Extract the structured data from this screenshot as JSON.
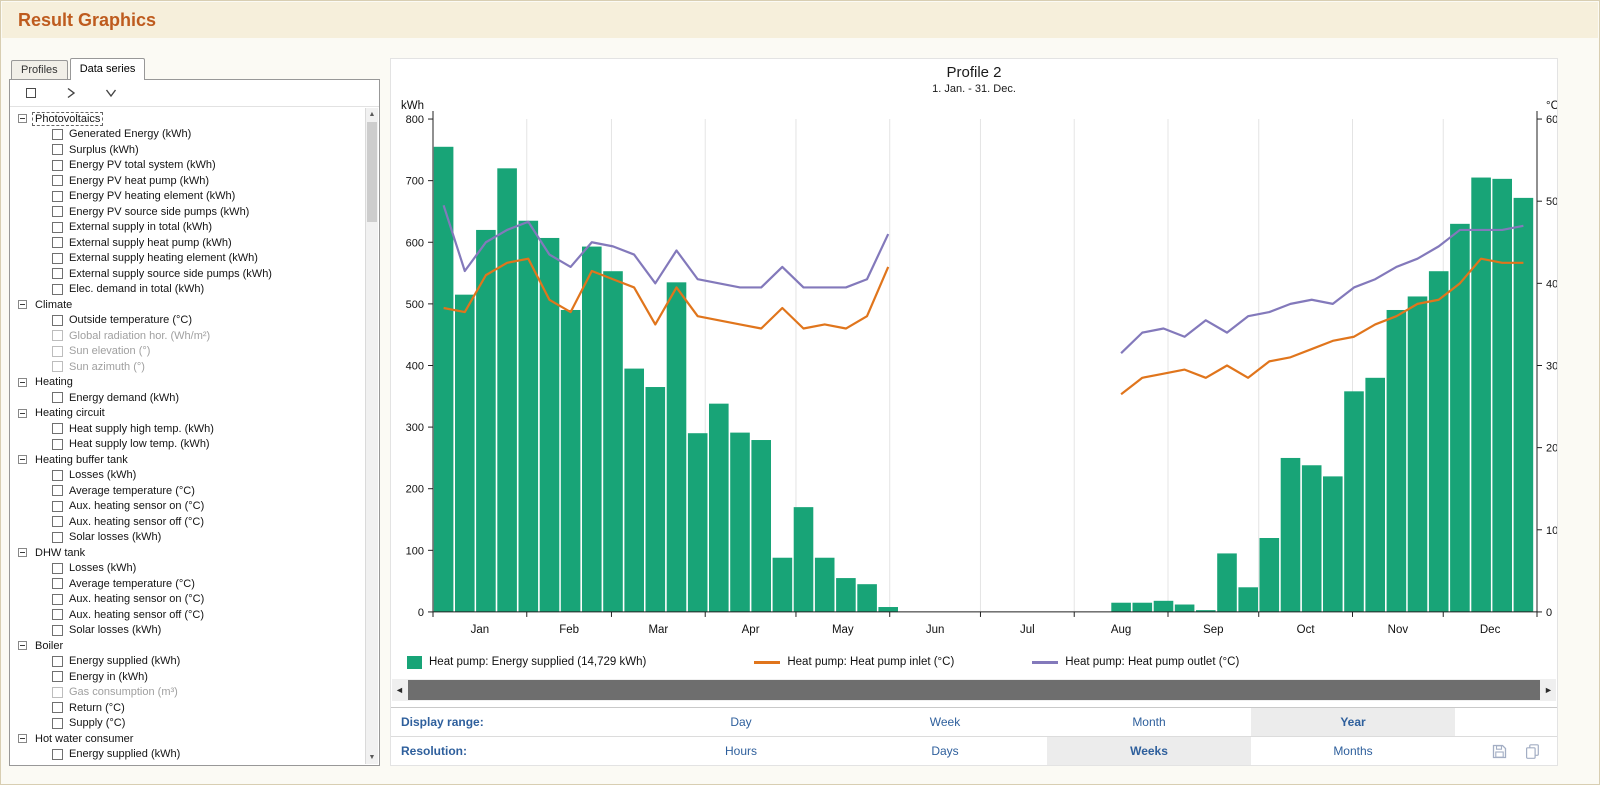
{
  "window": {
    "title": "Result Graphics"
  },
  "left_panel": {
    "tabs": [
      {
        "label": "Profiles",
        "active": false
      },
      {
        "label": "Data series",
        "active": true
      }
    ],
    "toolbar_icons": [
      "checkbox-icon",
      "chevron-right-icon",
      "chevron-down-icon"
    ],
    "tree": [
      {
        "label": "Photovoltaics",
        "focused": true,
        "children": [
          {
            "label": "Generated Energy (kWh)"
          },
          {
            "label": "Surplus (kWh)"
          },
          {
            "label": "Energy PV total system (kWh)"
          },
          {
            "label": "Energy PV heat pump (kWh)"
          },
          {
            "label": "Energy PV heating element (kWh)"
          },
          {
            "label": "Energy PV source side pumps (kWh)"
          },
          {
            "label": "External supply in total (kWh)"
          },
          {
            "label": "External supply heat pump (kWh)"
          },
          {
            "label": "External supply heating element (kWh)"
          },
          {
            "label": "External supply source side pumps (kWh)"
          },
          {
            "label": "Elec. demand in total (kWh)"
          }
        ]
      },
      {
        "label": "Climate",
        "children": [
          {
            "label": "Outside temperature (°C)"
          },
          {
            "label": "Global radiation hor. (Wh/m²)",
            "disabled": true
          },
          {
            "label": "Sun elevation (°)",
            "disabled": true
          },
          {
            "label": "Sun azimuth (°)",
            "disabled": true
          }
        ]
      },
      {
        "label": "Heating",
        "children": [
          {
            "label": "Energy demand (kWh)"
          }
        ]
      },
      {
        "label": "Heating circuit",
        "children": [
          {
            "label": "Heat supply high temp. (kWh)"
          },
          {
            "label": "Heat supply low temp. (kWh)"
          }
        ]
      },
      {
        "label": "Heating buffer tank",
        "children": [
          {
            "label": "Losses (kWh)"
          },
          {
            "label": "Average temperature (°C)"
          },
          {
            "label": "Aux. heating sensor on (°C)"
          },
          {
            "label": "Aux. heating sensor off (°C)"
          },
          {
            "label": "Solar losses (kWh)"
          }
        ]
      },
      {
        "label": "DHW tank",
        "children": [
          {
            "label": "Losses (kWh)"
          },
          {
            "label": "Average temperature (°C)"
          },
          {
            "label": "Aux. heating sensor on (°C)"
          },
          {
            "label": "Aux. heating sensor off (°C)"
          },
          {
            "label": "Solar losses (kWh)"
          }
        ]
      },
      {
        "label": "Boiler",
        "children": [
          {
            "label": "Energy supplied (kWh)"
          },
          {
            "label": "Energy in (kWh)"
          },
          {
            "label": "Gas consumption (m³)",
            "disabled": true
          },
          {
            "label": "Return (°C)"
          },
          {
            "label": "Supply (°C)"
          }
        ]
      },
      {
        "label": "Hot water consumer",
        "children": [
          {
            "label": "Energy supplied (kWh)"
          }
        ]
      }
    ]
  },
  "chart": {
    "title": "Profile 2",
    "subtitle": "1. Jan. - 31. Dec."
  },
  "chart_data": {
    "type": "bar",
    "note": "52 weekly values; bars on left kWh axis, lines on right °C axis",
    "month_labels": [
      "Jan",
      "Feb",
      "Mar",
      "Apr",
      "May",
      "Jun",
      "Jul",
      "Aug",
      "Sep",
      "Oct",
      "Nov",
      "Dec"
    ],
    "month_boundaries_day": [
      0,
      31,
      59,
      90,
      120,
      151,
      181,
      212,
      243,
      273,
      304,
      334,
      365
    ],
    "left_axis": {
      "label": "kWh",
      "min": 0,
      "max": 800,
      "step": 100
    },
    "right_axis": {
      "label": "°C",
      "min": 0,
      "max": 60,
      "step": 10
    },
    "grid_color": "#E4E4E4",
    "series": [
      {
        "name": "Heat pump: Energy supplied (14,729 kWh)",
        "type": "bar",
        "axis": "left",
        "color": "#18A477",
        "values": [
          755,
          515,
          620,
          720,
          635,
          607,
          490,
          593,
          553,
          395,
          365,
          535,
          290,
          338,
          291,
          279,
          88,
          170,
          88,
          55,
          45,
          8,
          0,
          0,
          0,
          0,
          0,
          0,
          0,
          0,
          0,
          0,
          15,
          15,
          18,
          12,
          3,
          95,
          40,
          120,
          250,
          238,
          220,
          358,
          380,
          490,
          512,
          553,
          630,
          705,
          703,
          672
        ]
      },
      {
        "name": "Heat pump: Heat pump inlet (°C)",
        "type": "line",
        "axis": "right",
        "color": "#E0751C",
        "values": [
          37,
          36.5,
          41,
          42.5,
          43,
          38,
          36.5,
          41.5,
          40.5,
          39.5,
          35,
          39.5,
          36,
          35.5,
          35,
          34.5,
          37,
          34.5,
          35,
          34.5,
          36,
          42,
          null,
          null,
          null,
          null,
          null,
          null,
          null,
          null,
          null,
          null,
          26.5,
          28.5,
          29,
          29.5,
          28.5,
          30,
          28.5,
          30.5,
          31,
          32,
          33,
          33.5,
          35,
          36,
          37.5,
          38,
          40,
          43,
          42.5,
          42.5
        ]
      },
      {
        "name": "Heat pump: Heat pump outlet (°C)",
        "type": "line",
        "axis": "right",
        "color": "#8379BB",
        "values": [
          49.5,
          41.5,
          45,
          46.5,
          47.5,
          43.5,
          42,
          45,
          44.5,
          43.5,
          40,
          44,
          40.5,
          40,
          39.5,
          39.5,
          42,
          39.5,
          39.5,
          39.5,
          40.5,
          46,
          null,
          null,
          null,
          null,
          null,
          null,
          null,
          null,
          null,
          null,
          31.5,
          34,
          34.5,
          33.5,
          35.5,
          34,
          36,
          36.5,
          37.5,
          38,
          37.5,
          39.5,
          40.5,
          42,
          43,
          44.5,
          46.5,
          46.5,
          46.5,
          47
        ]
      }
    ]
  },
  "controls": {
    "display_range": {
      "label": "Display range:",
      "options": [
        "Day",
        "Week",
        "Month",
        "Year"
      ],
      "selected": "Year"
    },
    "resolution": {
      "label": "Resolution:",
      "options": [
        "Hours",
        "Days",
        "Weeks",
        "Months"
      ],
      "selected": "Weeks"
    },
    "icons": [
      "save-icon",
      "copy-icon"
    ],
    "accent_text_color": "#2E5F9C"
  }
}
